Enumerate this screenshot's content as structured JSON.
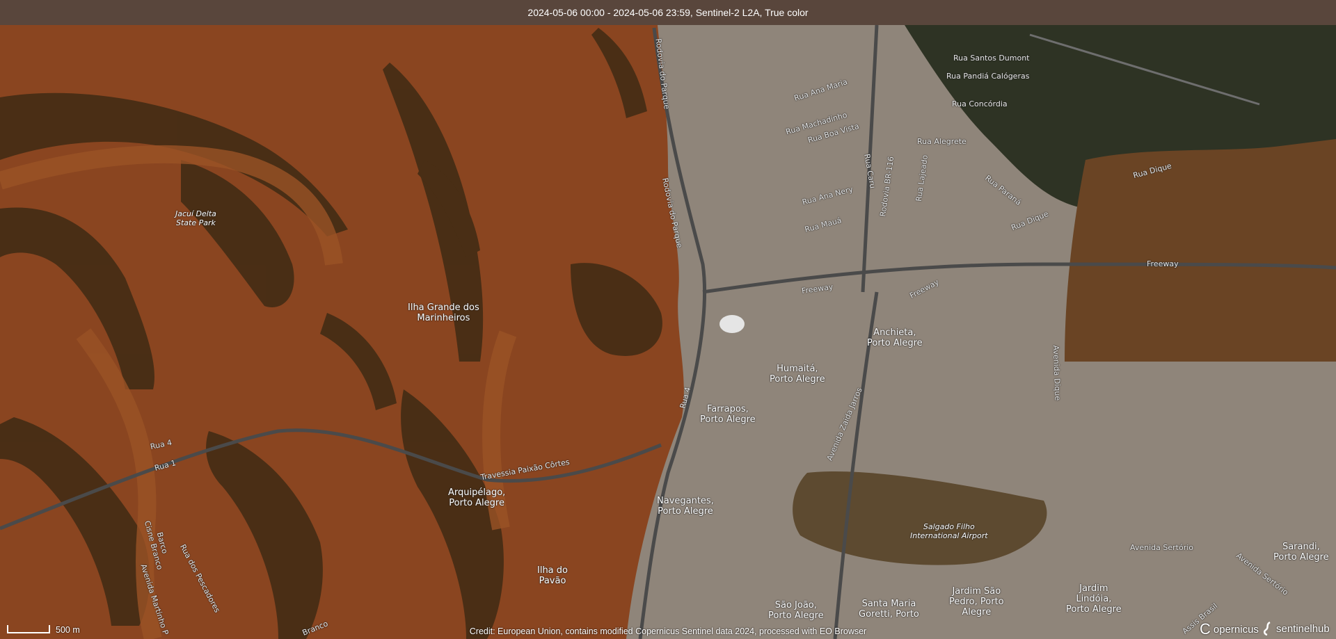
{
  "header": {
    "title": "2024-05-06 00:00 - 2024-05-06 23:59, Sentinel-2 L2A, True color"
  },
  "labels": {
    "rua_santos_dumont": "Rua Santos Dumont",
    "rua_pandia_calogeras": "Rua Pandiá Calógeras",
    "rua_concordia": "Rua Concórdia",
    "rua_ana_maria": "Rua Ana Maria",
    "rua_machadinho": "Rua Machadinho",
    "rua_boa_vista": "Rua Boa Vista",
    "rua_alegrete": "Rua Alegrete",
    "rua_dique_1": "Rua Dique",
    "rua_dique_2": "Rua Dique",
    "rua_parana": "Rua Paraná",
    "rua_ana_nery": "Rua Ana Nery",
    "rua_caru": "Rua Caru",
    "rodovia_br116": "Rodovia BR-116",
    "rua_lajeado": "Rua Lajeado",
    "rua_maua": "Rua Mauá",
    "rodovia_parque_1": "Rodovia do Parque",
    "rodovia_parque_2": "Rodovia do Parque",
    "freeway_1": "Freeway",
    "freeway_2": "Freeway",
    "freeway_3": "Freeway",
    "jacui_delta": "Jacuí Delta\nState Park",
    "ilha_grande": "Ilha Grande dos\nMarinheiros",
    "anchieta": "Anchieta,\nPorto Alegre",
    "humaita": "Humaitá,\nPorto Alegre",
    "farrapos": "Farrapos,\nPorto Alegre",
    "avenida_dique": "Avenida Dique",
    "avenida_zaida_jarros": "Avenida Zaida Jarros",
    "rua_4_a": "Rua 4",
    "rua_4_b": "Rua 4",
    "rua_1": "Rua 1",
    "travessia": "Travessia Paixão Côrtes",
    "arquipelago": "Arquipélago,\nPorto Alegre",
    "navegantes": "Navegantes,\nPorto Alegre",
    "salgado_filho": "Salgado Filho\nInternational Airport",
    "ilha_pavao": "Ilha do\nPavão",
    "barco_cisne": "Barco\nCisne Branco",
    "rua_pescadores": "Rua dos Pescadores",
    "avenida_martinho": "Avenida Martinho P",
    "branco": "Branco",
    "sao_joao": "São João,\nPorto Alegre",
    "santa_maria": "Santa Maria\nGoretti, Porto",
    "jardim_sao_pedro": "Jardim São\nPedro, Porto\nAlegre",
    "jardim_lindoia": "Jardim\nLindóia,\nPorto Alegre",
    "avenida_sertorio_1": "Avenida Sertório",
    "avenida_sertorio_2": "Avenida Sertório",
    "assis_brasil": "Assis Brasil",
    "sarandi": "Sarandi,\nPorto Alegre"
  },
  "scale": {
    "label": "500 m"
  },
  "credit": "Credit: European Union, contains modified Copernicus Sentinel data 2024, processed with EO Browser",
  "logos": {
    "copernicus": "opernicus",
    "sentinelhub": "sentinelhub"
  },
  "colors": {
    "water": "#8a4520",
    "land_dark": "#2a2a1a",
    "urban": "#9a8f82",
    "airport": "#5d5a4a"
  }
}
